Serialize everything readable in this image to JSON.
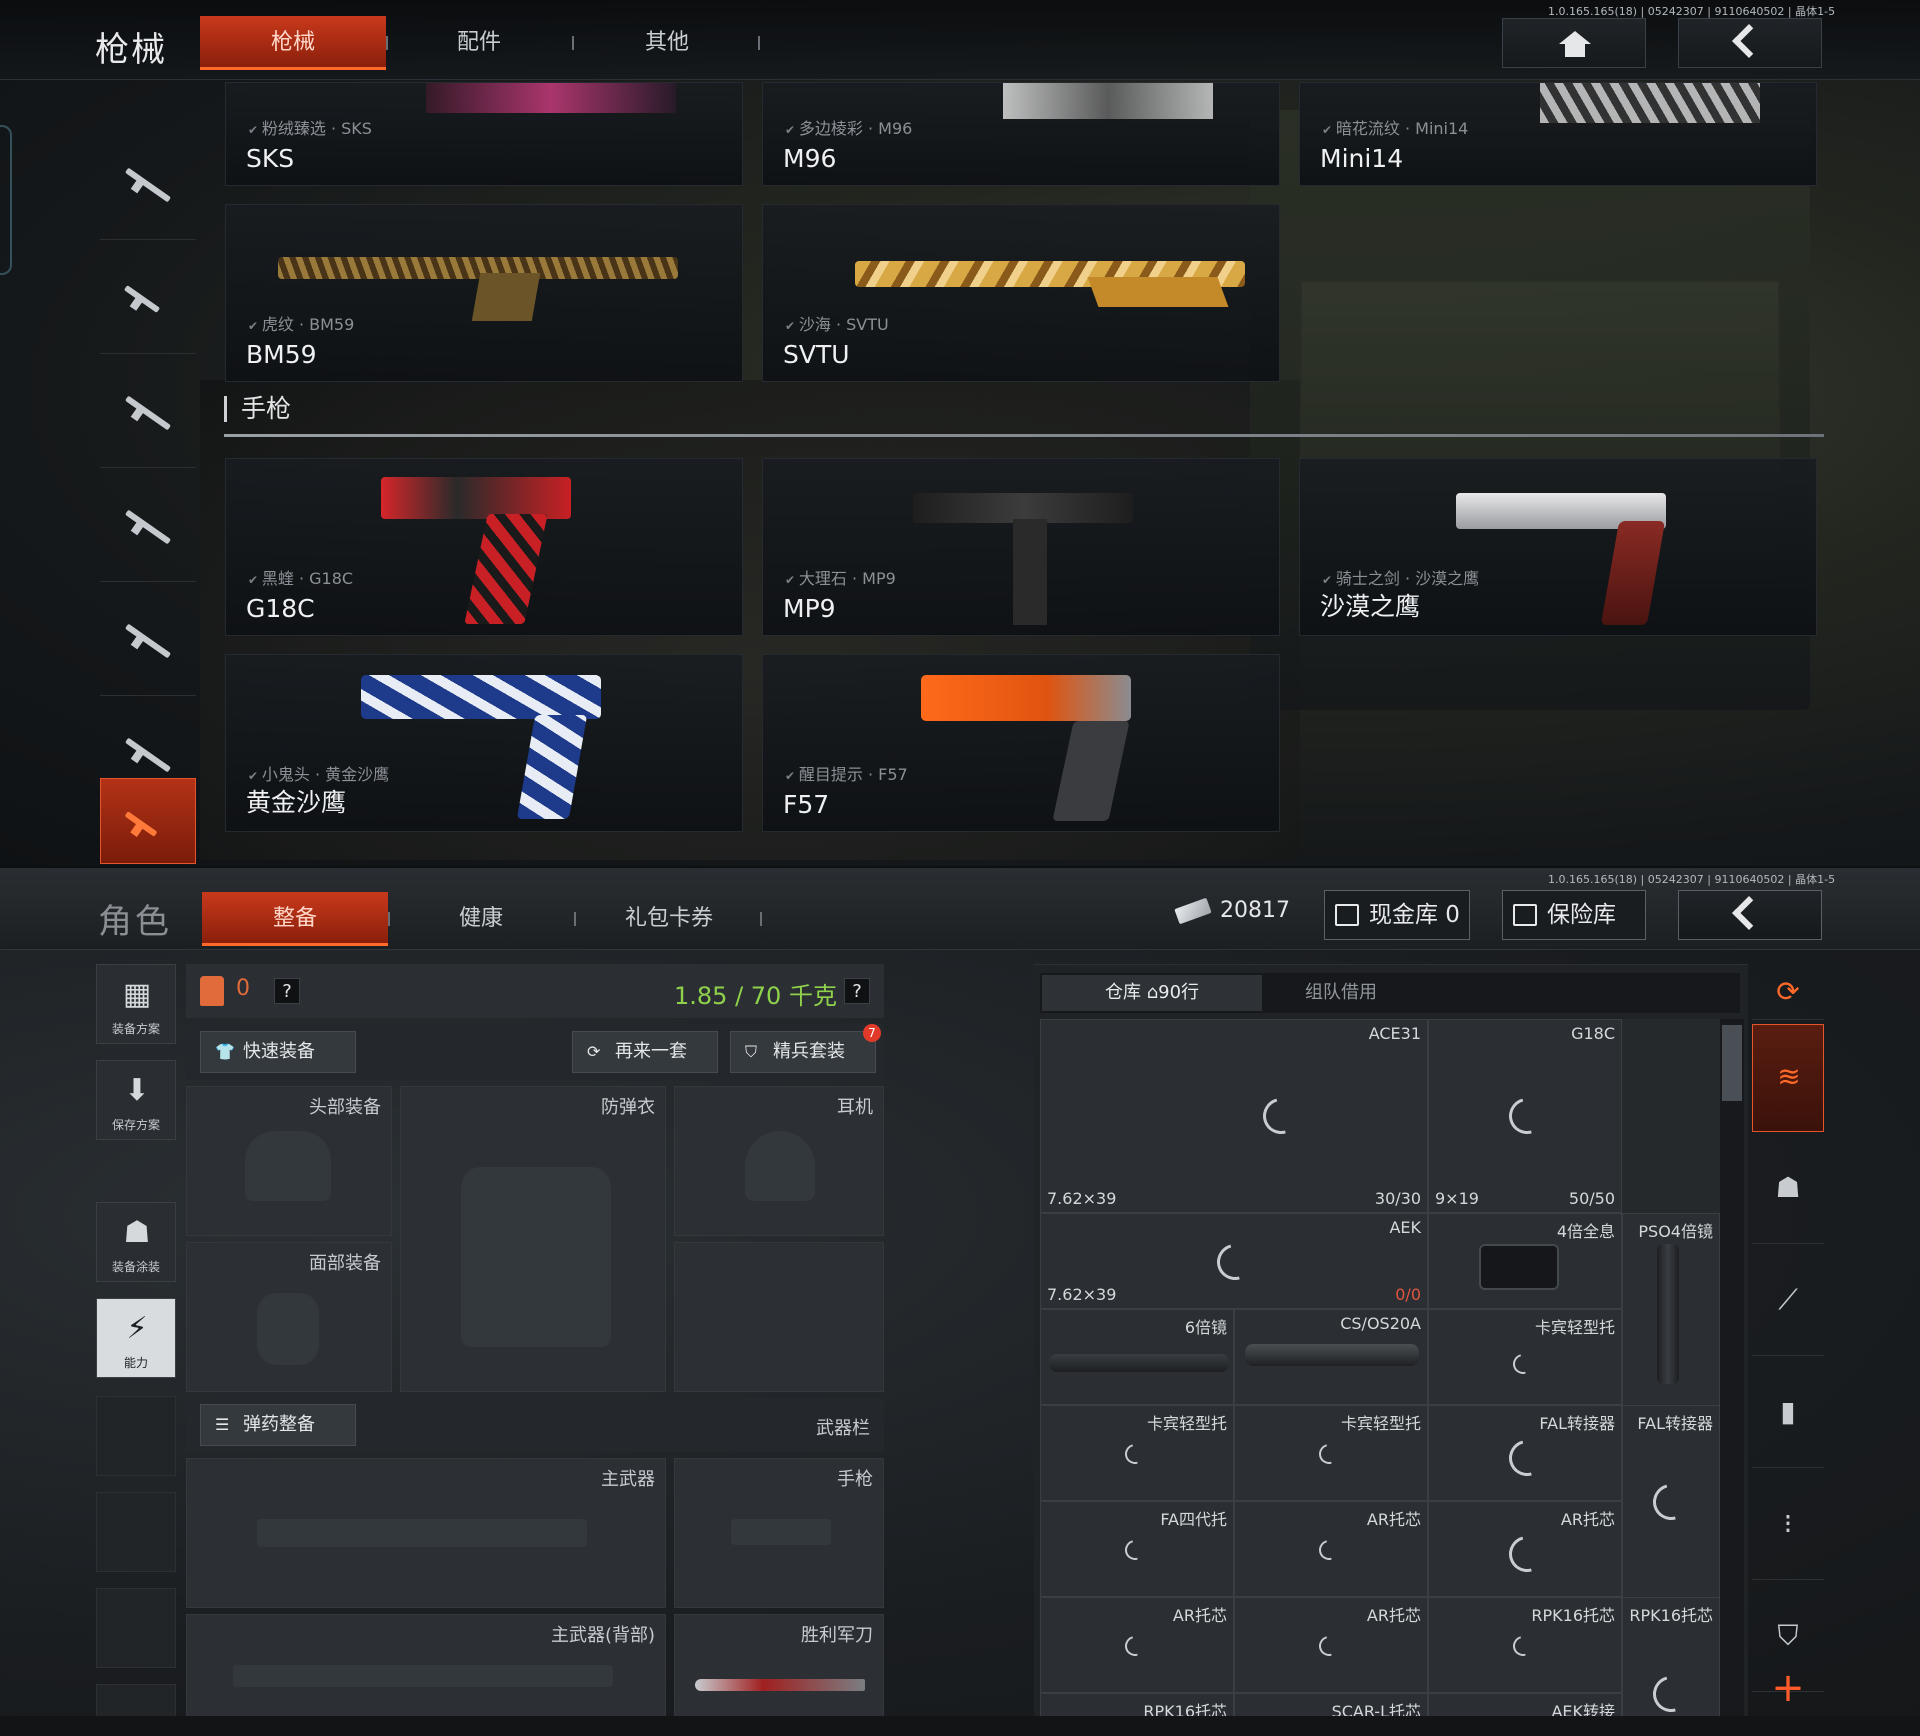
{
  "top": {
    "title": "枪械",
    "version": "1.0.165.165(18) | 05242307 | 9110640502 | 晶体1-5",
    "tabs": [
      {
        "label": "枪械",
        "active": true
      },
      {
        "label": "配件",
        "active": false
      },
      {
        "label": "其他",
        "active": false
      }
    ],
    "nav": {
      "home_icon": "home-icon",
      "back_icon": "chevron-left-icon"
    },
    "sidebar_icons": [
      "assault-rifle-icon",
      "smg-icon",
      "sniper-icon",
      "dmr-icon",
      "rifle-icon",
      "shotgun-icon",
      "pistol-icon"
    ],
    "rifle_cards": [
      {
        "skin": "粉绒臻选 · SKS",
        "name": "SKS"
      },
      {
        "skin": "多边棱彩 · M96",
        "name": "M96"
      },
      {
        "skin": "暗花流纹 · Mini14",
        "name": "Mini14"
      },
      {
        "skin": "虎纹 · BM59",
        "name": "BM59"
      },
      {
        "skin": "沙海 · SVTU",
        "name": "SVTU"
      }
    ],
    "section_pistol": "手枪",
    "pistol_cards": [
      {
        "skin": "黑蝰 · G18C",
        "name": "G18C"
      },
      {
        "skin": "大理石 · MP9",
        "name": "MP9"
      },
      {
        "skin": "骑士之剑 · 沙漠之鹰",
        "name": "沙漠之鹰"
      },
      {
        "skin": "小鬼头 · 黄金沙鹰",
        "name": "黄金沙鹰"
      },
      {
        "skin": "醒目提示 · F57",
        "name": "F57"
      }
    ]
  },
  "bottom": {
    "title": "角色",
    "version": "1.0.165.165(18) | 05242307 | 9110640502 | 晶体1-5",
    "tabs": [
      {
        "label": "整备",
        "active": true
      },
      {
        "label": "健康",
        "active": false
      },
      {
        "label": "礼包卡券",
        "active": false
      }
    ],
    "money": "20817",
    "cash_vault": "现金库 0",
    "insurance": "保险库",
    "left_buttons": [
      {
        "label": "装备方案",
        "glyph": "▦"
      },
      {
        "label": "保存方案",
        "glyph": "⬇"
      },
      {
        "label": "装备涂装",
        "glyph": "☗"
      },
      {
        "label": "能力",
        "glyph": "⚡"
      }
    ],
    "equip": {
      "vest_count": "0",
      "help": "?",
      "weight": "1.85 / 70 千克",
      "quick_equip": "快速装备",
      "again": "再来一套",
      "elite": "精兵套装",
      "elite_badge": "7",
      "slots": {
        "head": "头部装备",
        "armor": "防弹衣",
        "ear": "耳机",
        "face": "面部装备",
        "ammo": "弹药整备",
        "weapon_bar": "武器栏",
        "primary": "主武器",
        "pistol": "手枪",
        "primary_back": "主武器(背部)",
        "knife": "胜利军刀"
      }
    },
    "warehouse": {
      "tab1": "仓库",
      "tab1_rows": "90行",
      "tab2": "组队借用",
      "items": [
        {
          "name": "ACE31",
          "bl": "7.62×39",
          "br": "30/30"
        },
        {
          "name": "G18C",
          "bl": "9×19",
          "br": "50/50"
        },
        {
          "name": "AEK",
          "bl": "7.62×39",
          "br": "0/0"
        },
        {
          "name": "4倍全息"
        },
        {
          "name": "PSO4倍镜"
        },
        {
          "name": "6倍镜"
        },
        {
          "name": "CS/OS20A"
        },
        {
          "name": "卡宾轻型托"
        },
        {
          "name": "卡宾轻型托"
        },
        {
          "name": "卡宾轻型托"
        },
        {
          "name": "FAL转接器"
        },
        {
          "name": "FAL转接器"
        },
        {
          "name": "FA四代托"
        },
        {
          "name": "AR托芯"
        },
        {
          "name": "AR托芯"
        },
        {
          "name": "AR托芯"
        },
        {
          "name": "AR托芯"
        },
        {
          "name": "RPK16托芯"
        },
        {
          "name": "RPK16托芯"
        },
        {
          "name": "RPK16托芯"
        },
        {
          "name": "SCAR-L托芯"
        },
        {
          "name": "AEK转接"
        }
      ]
    },
    "right_icons": [
      "warehouse-refresh-icon",
      "stack-icon",
      "helmet-icon",
      "rifle-icon",
      "magazine-icon",
      "bullet-icon",
      "armor-icon"
    ]
  },
  "colors": {
    "accent": "#c9391b",
    "accent_bright": "#ff6a2a",
    "weight_green": "#8fd14b",
    "red_text": "#e05540"
  }
}
